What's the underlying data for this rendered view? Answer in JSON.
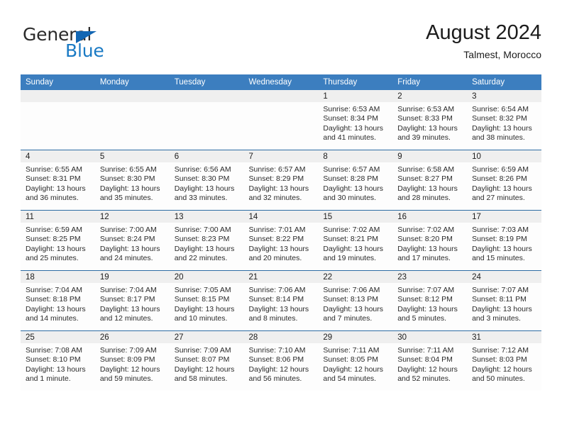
{
  "logo": {
    "line1": "General",
    "line2": "Blue",
    "triangle_color": "#1266b3",
    "line1_color": "#2b2b2b",
    "line2_color": "#1a7ac4"
  },
  "header": {
    "title": "August 2024",
    "subtitle": "Talmest, Morocco"
  },
  "colors": {
    "header_row_bg": "#3c7ebf",
    "row_divider": "#2e6da4",
    "date_band_bg": "#efefef",
    "cell_bg": "#fdfdfd"
  },
  "weekday_headers": [
    "Sunday",
    "Monday",
    "Tuesday",
    "Wednesday",
    "Thursday",
    "Friday",
    "Saturday"
  ],
  "weeks": [
    [
      {
        "day": "",
        "sunrise": "",
        "sunset": "",
        "daylight1": "",
        "daylight2": "",
        "empty": true
      },
      {
        "day": "",
        "sunrise": "",
        "sunset": "",
        "daylight1": "",
        "daylight2": "",
        "empty": true
      },
      {
        "day": "",
        "sunrise": "",
        "sunset": "",
        "daylight1": "",
        "daylight2": "",
        "empty": true
      },
      {
        "day": "",
        "sunrise": "",
        "sunset": "",
        "daylight1": "",
        "daylight2": "",
        "empty": true
      },
      {
        "day": "1",
        "sunrise": "Sunrise: 6:53 AM",
        "sunset": "Sunset: 8:34 PM",
        "daylight1": "Daylight: 13 hours",
        "daylight2": "and 41 minutes."
      },
      {
        "day": "2",
        "sunrise": "Sunrise: 6:53 AM",
        "sunset": "Sunset: 8:33 PM",
        "daylight1": "Daylight: 13 hours",
        "daylight2": "and 39 minutes."
      },
      {
        "day": "3",
        "sunrise": "Sunrise: 6:54 AM",
        "sunset": "Sunset: 8:32 PM",
        "daylight1": "Daylight: 13 hours",
        "daylight2": "and 38 minutes."
      }
    ],
    [
      {
        "day": "4",
        "sunrise": "Sunrise: 6:55 AM",
        "sunset": "Sunset: 8:31 PM",
        "daylight1": "Daylight: 13 hours",
        "daylight2": "and 36 minutes."
      },
      {
        "day": "5",
        "sunrise": "Sunrise: 6:55 AM",
        "sunset": "Sunset: 8:30 PM",
        "daylight1": "Daylight: 13 hours",
        "daylight2": "and 35 minutes."
      },
      {
        "day": "6",
        "sunrise": "Sunrise: 6:56 AM",
        "sunset": "Sunset: 8:30 PM",
        "daylight1": "Daylight: 13 hours",
        "daylight2": "and 33 minutes."
      },
      {
        "day": "7",
        "sunrise": "Sunrise: 6:57 AM",
        "sunset": "Sunset: 8:29 PM",
        "daylight1": "Daylight: 13 hours",
        "daylight2": "and 32 minutes."
      },
      {
        "day": "8",
        "sunrise": "Sunrise: 6:57 AM",
        "sunset": "Sunset: 8:28 PM",
        "daylight1": "Daylight: 13 hours",
        "daylight2": "and 30 minutes."
      },
      {
        "day": "9",
        "sunrise": "Sunrise: 6:58 AM",
        "sunset": "Sunset: 8:27 PM",
        "daylight1": "Daylight: 13 hours",
        "daylight2": "and 28 minutes."
      },
      {
        "day": "10",
        "sunrise": "Sunrise: 6:59 AM",
        "sunset": "Sunset: 8:26 PM",
        "daylight1": "Daylight: 13 hours",
        "daylight2": "and 27 minutes."
      }
    ],
    [
      {
        "day": "11",
        "sunrise": "Sunrise: 6:59 AM",
        "sunset": "Sunset: 8:25 PM",
        "daylight1": "Daylight: 13 hours",
        "daylight2": "and 25 minutes."
      },
      {
        "day": "12",
        "sunrise": "Sunrise: 7:00 AM",
        "sunset": "Sunset: 8:24 PM",
        "daylight1": "Daylight: 13 hours",
        "daylight2": "and 24 minutes."
      },
      {
        "day": "13",
        "sunrise": "Sunrise: 7:00 AM",
        "sunset": "Sunset: 8:23 PM",
        "daylight1": "Daylight: 13 hours",
        "daylight2": "and 22 minutes."
      },
      {
        "day": "14",
        "sunrise": "Sunrise: 7:01 AM",
        "sunset": "Sunset: 8:22 PM",
        "daylight1": "Daylight: 13 hours",
        "daylight2": "and 20 minutes."
      },
      {
        "day": "15",
        "sunrise": "Sunrise: 7:02 AM",
        "sunset": "Sunset: 8:21 PM",
        "daylight1": "Daylight: 13 hours",
        "daylight2": "and 19 minutes."
      },
      {
        "day": "16",
        "sunrise": "Sunrise: 7:02 AM",
        "sunset": "Sunset: 8:20 PM",
        "daylight1": "Daylight: 13 hours",
        "daylight2": "and 17 minutes."
      },
      {
        "day": "17",
        "sunrise": "Sunrise: 7:03 AM",
        "sunset": "Sunset: 8:19 PM",
        "daylight1": "Daylight: 13 hours",
        "daylight2": "and 15 minutes."
      }
    ],
    [
      {
        "day": "18",
        "sunrise": "Sunrise: 7:04 AM",
        "sunset": "Sunset: 8:18 PM",
        "daylight1": "Daylight: 13 hours",
        "daylight2": "and 14 minutes."
      },
      {
        "day": "19",
        "sunrise": "Sunrise: 7:04 AM",
        "sunset": "Sunset: 8:17 PM",
        "daylight1": "Daylight: 13 hours",
        "daylight2": "and 12 minutes."
      },
      {
        "day": "20",
        "sunrise": "Sunrise: 7:05 AM",
        "sunset": "Sunset: 8:15 PM",
        "daylight1": "Daylight: 13 hours",
        "daylight2": "and 10 minutes."
      },
      {
        "day": "21",
        "sunrise": "Sunrise: 7:06 AM",
        "sunset": "Sunset: 8:14 PM",
        "daylight1": "Daylight: 13 hours",
        "daylight2": "and 8 minutes."
      },
      {
        "day": "22",
        "sunrise": "Sunrise: 7:06 AM",
        "sunset": "Sunset: 8:13 PM",
        "daylight1": "Daylight: 13 hours",
        "daylight2": "and 7 minutes."
      },
      {
        "day": "23",
        "sunrise": "Sunrise: 7:07 AM",
        "sunset": "Sunset: 8:12 PM",
        "daylight1": "Daylight: 13 hours",
        "daylight2": "and 5 minutes."
      },
      {
        "day": "24",
        "sunrise": "Sunrise: 7:07 AM",
        "sunset": "Sunset: 8:11 PM",
        "daylight1": "Daylight: 13 hours",
        "daylight2": "and 3 minutes."
      }
    ],
    [
      {
        "day": "25",
        "sunrise": "Sunrise: 7:08 AM",
        "sunset": "Sunset: 8:10 PM",
        "daylight1": "Daylight: 13 hours",
        "daylight2": "and 1 minute."
      },
      {
        "day": "26",
        "sunrise": "Sunrise: 7:09 AM",
        "sunset": "Sunset: 8:09 PM",
        "daylight1": "Daylight: 12 hours",
        "daylight2": "and 59 minutes."
      },
      {
        "day": "27",
        "sunrise": "Sunrise: 7:09 AM",
        "sunset": "Sunset: 8:07 PM",
        "daylight1": "Daylight: 12 hours",
        "daylight2": "and 58 minutes."
      },
      {
        "day": "28",
        "sunrise": "Sunrise: 7:10 AM",
        "sunset": "Sunset: 8:06 PM",
        "daylight1": "Daylight: 12 hours",
        "daylight2": "and 56 minutes."
      },
      {
        "day": "29",
        "sunrise": "Sunrise: 7:11 AM",
        "sunset": "Sunset: 8:05 PM",
        "daylight1": "Daylight: 12 hours",
        "daylight2": "and 54 minutes."
      },
      {
        "day": "30",
        "sunrise": "Sunrise: 7:11 AM",
        "sunset": "Sunset: 8:04 PM",
        "daylight1": "Daylight: 12 hours",
        "daylight2": "and 52 minutes."
      },
      {
        "day": "31",
        "sunrise": "Sunrise: 7:12 AM",
        "sunset": "Sunset: 8:03 PM",
        "daylight1": "Daylight: 12 hours",
        "daylight2": "and 50 minutes."
      }
    ]
  ]
}
